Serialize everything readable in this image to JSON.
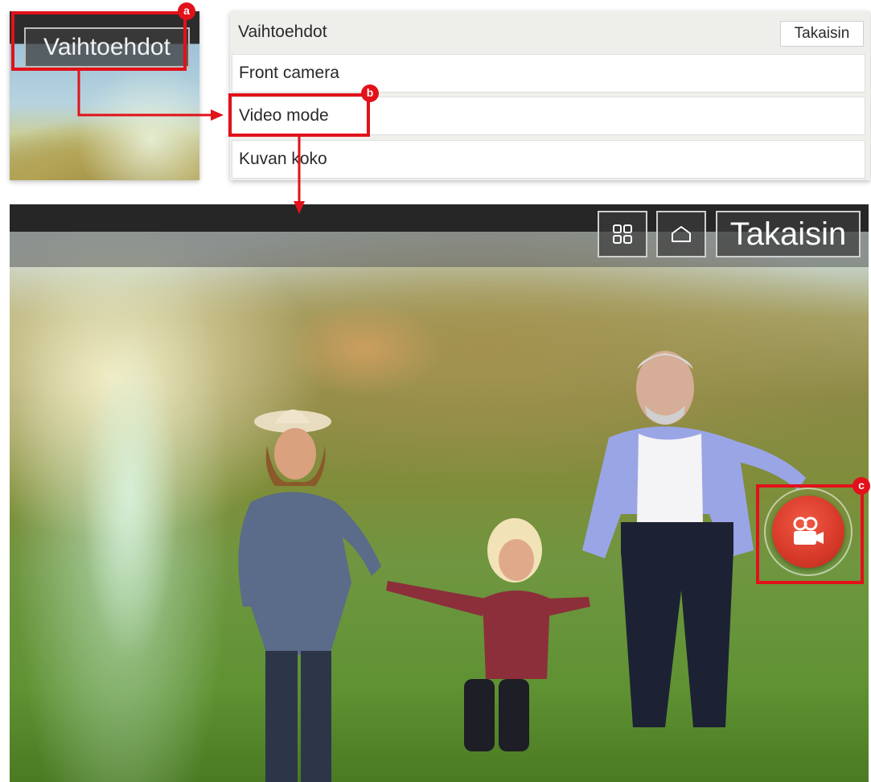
{
  "preview": {
    "options_button_label": "Vaihtoehdot"
  },
  "menu": {
    "title": "Vaihtoehdot",
    "back_label": "Takaisin",
    "items": [
      {
        "label": "Front camera"
      },
      {
        "label": "Video mode"
      },
      {
        "label": "Kuvan koko"
      }
    ]
  },
  "camera_view": {
    "back_label": "Takaisin",
    "apps_icon": "grid-icon",
    "home_icon": "home-icon",
    "record_icon": "video-camera-icon",
    "record_color": "#d93b2a"
  },
  "callouts": {
    "a": "a",
    "b": "b",
    "c": "c",
    "color": "#e2111a"
  }
}
